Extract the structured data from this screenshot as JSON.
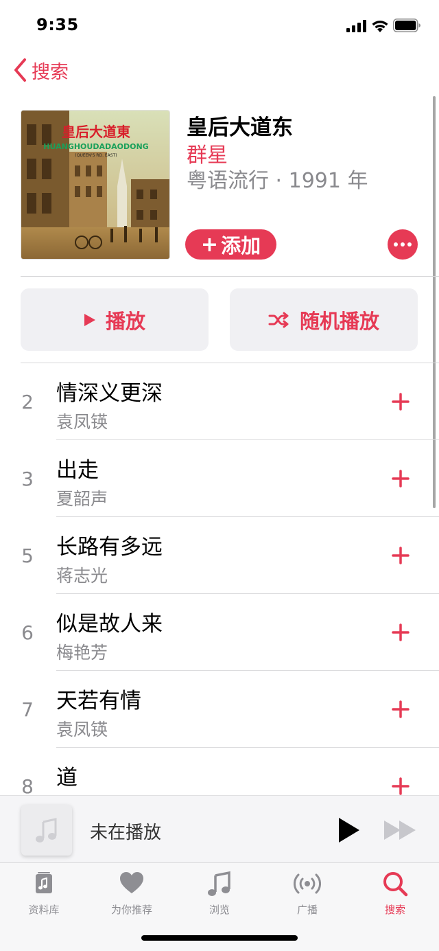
{
  "status_bar": {
    "time": "9:35"
  },
  "nav": {
    "back_label": "搜索"
  },
  "album": {
    "title": "皇后大道东",
    "artist": "群星",
    "meta": "粤语流行 · 1991 年",
    "cover_title": "皇后大道東",
    "cover_subtitle": "HUANGHOUDADAODONG",
    "cover_note": "(QUEEN'S RD. EAST)"
  },
  "actions": {
    "add_label": "添加",
    "play_label": "播放",
    "shuffle_label": "随机播放"
  },
  "tracks": [
    {
      "number": "2",
      "title": "情深义更深",
      "artist": "袁凤锳"
    },
    {
      "number": "3",
      "title": "出走",
      "artist": "夏韶声"
    },
    {
      "number": "5",
      "title": "长路有多远",
      "artist": "蒋志光"
    },
    {
      "number": "6",
      "title": "似是故人来",
      "artist": "梅艳芳"
    },
    {
      "number": "7",
      "title": "天若有情",
      "artist": "袁凤锳"
    },
    {
      "number": "8",
      "title": "道",
      "artist": ""
    }
  ],
  "mini_player": {
    "status": "未在播放"
  },
  "tabs": [
    {
      "label": "资料库",
      "icon": "library-icon"
    },
    {
      "label": "为你推荐",
      "icon": "heart-icon"
    },
    {
      "label": "浏览",
      "icon": "music-note-icon"
    },
    {
      "label": "广播",
      "icon": "radio-icon"
    },
    {
      "label": "搜索",
      "icon": "search-icon",
      "active": true
    }
  ],
  "colors": {
    "accent": "#e63a55",
    "secondary_text": "#8a8a8e",
    "button_bg": "#f0f0f3"
  }
}
